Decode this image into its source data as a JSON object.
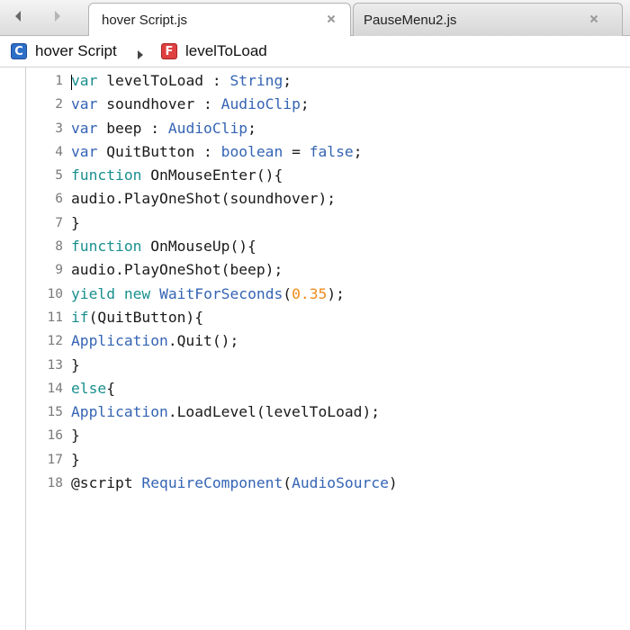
{
  "tabs": [
    {
      "label": "hover Script.js",
      "active": true
    },
    {
      "label": "PauseMenu2.js",
      "active": false
    }
  ],
  "breadcrumb": {
    "class_icon_letter": "C",
    "class_name": "hover Script",
    "function_icon_letter": "F",
    "function_name": "levelToLoad"
  },
  "colors": {
    "keyword": "#1a8f8f",
    "type": "#3464b4",
    "number": "#f08a1e",
    "plain": "#1a1a1a",
    "line_number": "#7a7a7a"
  },
  "icons": [
    "back-arrow-icon",
    "forward-arrow-icon",
    "close-tab-icon",
    "class-icon",
    "breadcrumb-separator-icon",
    "function-icon"
  ],
  "code": [
    {
      "num": "1",
      "tokens": [
        {
          "t": "var",
          "k": "keyword"
        },
        {
          "t": " levelToLoad : ",
          "k": "plain"
        },
        {
          "t": "String",
          "k": "type"
        },
        {
          "t": ";",
          "k": "plain"
        }
      ]
    },
    {
      "num": "2",
      "tokens": [
        {
          "t": "var",
          "k": "type"
        },
        {
          "t": " soundhover : ",
          "k": "plain"
        },
        {
          "t": "AudioClip",
          "k": "type"
        },
        {
          "t": ";",
          "k": "plain"
        }
      ]
    },
    {
      "num": "3",
      "tokens": [
        {
          "t": "var",
          "k": "type"
        },
        {
          "t": " beep : ",
          "k": "plain"
        },
        {
          "t": "AudioClip",
          "k": "type"
        },
        {
          "t": ";",
          "k": "plain"
        }
      ]
    },
    {
      "num": "4",
      "tokens": [
        {
          "t": "var",
          "k": "type"
        },
        {
          "t": " QuitButton : ",
          "k": "plain"
        },
        {
          "t": "boolean",
          "k": "type"
        },
        {
          "t": " = ",
          "k": "plain"
        },
        {
          "t": "false",
          "k": "type"
        },
        {
          "t": ";",
          "k": "plain"
        }
      ]
    },
    {
      "num": "5",
      "tokens": [
        {
          "t": "function",
          "k": "keyword"
        },
        {
          "t": " OnMouseEnter(){",
          "k": "plain"
        }
      ]
    },
    {
      "num": "6",
      "tokens": [
        {
          "t": "audio.PlayOneShot(soundhover);",
          "k": "plain"
        }
      ]
    },
    {
      "num": "7",
      "tokens": [
        {
          "t": "}",
          "k": "plain"
        }
      ]
    },
    {
      "num": "8",
      "tokens": [
        {
          "t": "function",
          "k": "keyword"
        },
        {
          "t": " OnMouseUp(){",
          "k": "plain"
        }
      ]
    },
    {
      "num": "9",
      "tokens": [
        {
          "t": "audio.PlayOneShot(beep);",
          "k": "plain"
        }
      ]
    },
    {
      "num": "10",
      "tokens": [
        {
          "t": "yield",
          "k": "keyword"
        },
        {
          "t": " ",
          "k": "plain"
        },
        {
          "t": "new",
          "k": "keyword"
        },
        {
          "t": " ",
          "k": "plain"
        },
        {
          "t": "WaitForSeconds",
          "k": "type"
        },
        {
          "t": "(",
          "k": "plain"
        },
        {
          "t": "0.35",
          "k": "number"
        },
        {
          "t": ");",
          "k": "plain"
        }
      ]
    },
    {
      "num": "11",
      "tokens": [
        {
          "t": "if",
          "k": "keyword"
        },
        {
          "t": "(QuitButton){",
          "k": "plain"
        }
      ]
    },
    {
      "num": "12",
      "tokens": [
        {
          "t": "Application",
          "k": "type"
        },
        {
          "t": ".Quit();",
          "k": "plain"
        }
      ]
    },
    {
      "num": "13",
      "tokens": [
        {
          "t": "}",
          "k": "plain"
        }
      ]
    },
    {
      "num": "14",
      "tokens": [
        {
          "t": "else",
          "k": "keyword"
        },
        {
          "t": "{",
          "k": "plain"
        }
      ]
    },
    {
      "num": "15",
      "tokens": [
        {
          "t": "Application",
          "k": "type"
        },
        {
          "t": ".LoadLevel(levelToLoad);",
          "k": "plain"
        }
      ]
    },
    {
      "num": "16",
      "tokens": [
        {
          "t": "}",
          "k": "plain"
        }
      ]
    },
    {
      "num": "17",
      "tokens": [
        {
          "t": "}",
          "k": "plain"
        }
      ]
    },
    {
      "num": "18",
      "tokens": [
        {
          "t": "@script ",
          "k": "plain"
        },
        {
          "t": "RequireComponent",
          "k": "type"
        },
        {
          "t": "(",
          "k": "plain"
        },
        {
          "t": "AudioSource",
          "k": "type"
        },
        {
          "t": ")",
          "k": "plain"
        }
      ]
    }
  ]
}
